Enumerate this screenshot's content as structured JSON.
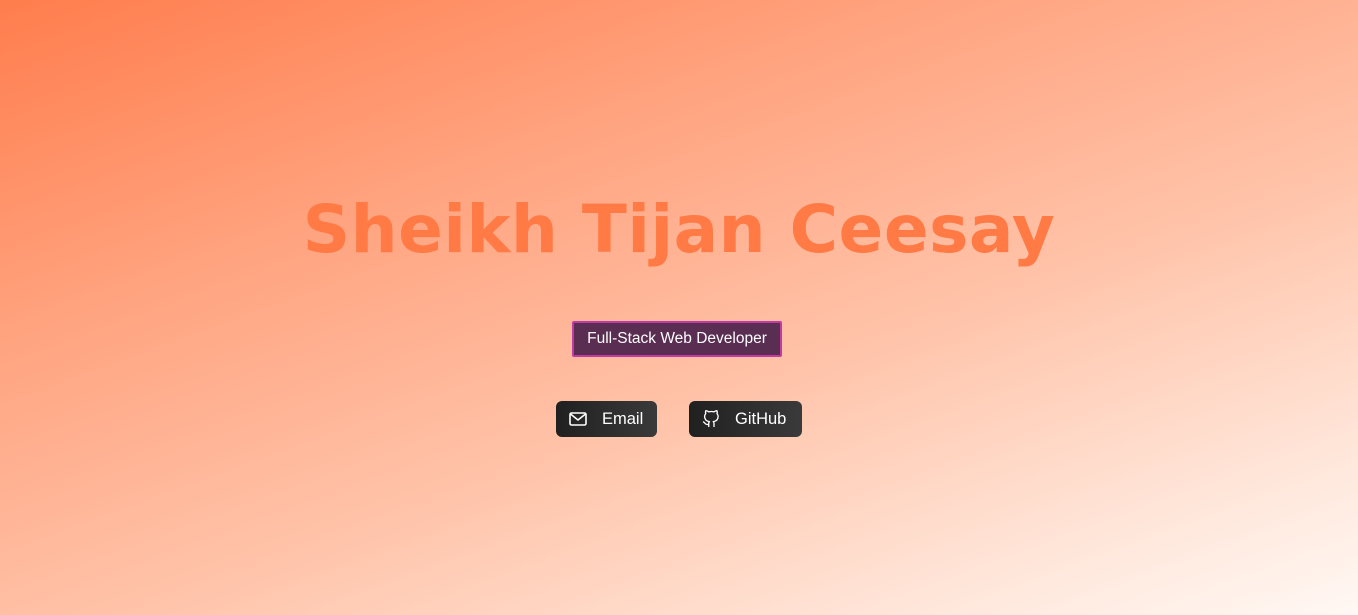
{
  "hero": {
    "name": "Sheikh Tijan Ceesay",
    "role": "Full-Stack Web Developer"
  },
  "links": {
    "email_label": "Email",
    "github_label": "GitHub"
  },
  "icons": {
    "email": "mail-icon",
    "github": "github-icon"
  },
  "colors": {
    "name": "#ff7a45",
    "badge_bg": "#5a2d52",
    "badge_border": "#c23aa3",
    "button_bg": "#2a2a2a"
  }
}
